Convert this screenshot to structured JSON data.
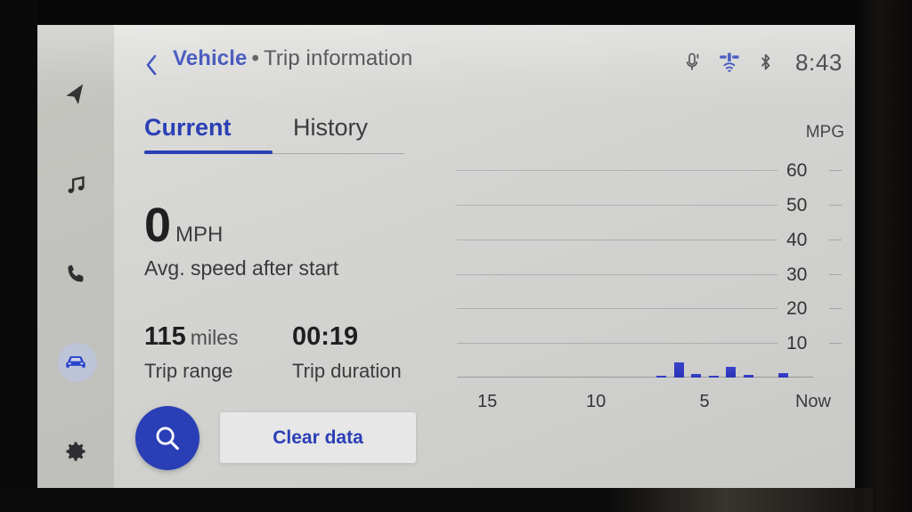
{
  "header": {
    "back_icon": "chevron-left-icon",
    "breadcrumb_parent": "Vehicle",
    "breadcrumb_separator": "•",
    "breadcrumb_current": "Trip information",
    "status_icons": [
      "mic-muted-icon",
      "gps-satellite-icon",
      "bluetooth-icon"
    ],
    "clock": "8:43"
  },
  "sidebar": {
    "items": [
      {
        "icon": "navigation-arrow-icon",
        "active": false
      },
      {
        "icon": "music-note-icon",
        "active": false
      },
      {
        "icon": "phone-icon",
        "active": false
      },
      {
        "icon": "car-icon",
        "active": true
      },
      {
        "icon": "gear-icon",
        "active": false
      }
    ]
  },
  "tabs": [
    {
      "label": "Current",
      "active": true
    },
    {
      "label": "History",
      "active": false
    }
  ],
  "stats": {
    "primary": {
      "value": "0",
      "unit": "MPH",
      "label": "Avg. speed after start"
    },
    "secondary": [
      {
        "value": "115",
        "unit": "miles",
        "label": "Trip range"
      },
      {
        "value": "00:19",
        "unit": "",
        "label": "Trip duration"
      }
    ]
  },
  "actions": {
    "search_icon": "search-icon",
    "clear_label": "Clear data"
  },
  "colors": {
    "accent_blue": "#2a3fb5",
    "bar_blue": "#2f37c4",
    "screen_bg": "#d6d7d4",
    "text_dark": "#333436"
  },
  "chart_data": {
    "type": "bar",
    "title": "",
    "xlabel": "",
    "ylabel": "MPG",
    "ylim": [
      0,
      65
    ],
    "yticks": [
      10,
      20,
      30,
      40,
      50,
      60
    ],
    "xticks": [
      {
        "label": "15",
        "pos": 15
      },
      {
        "label": "10",
        "pos": 10
      },
      {
        "label": "5",
        "pos": 5
      },
      {
        "label": "Now",
        "pos": 0
      }
    ],
    "xtick_note": "minutes ago",
    "grid": true,
    "legend": "none",
    "x": [
      15,
      14,
      13,
      12,
      11,
      10,
      9,
      8,
      7,
      6.2,
      5.4,
      4.6,
      3.8,
      3.0,
      2.2,
      1.4,
      0.6
    ],
    "values": [
      0,
      0,
      0,
      0,
      0,
      0,
      0,
      0,
      0.3,
      4.4,
      1.1,
      0.2,
      3.0,
      0.9,
      0,
      1.2,
      0
    ]
  }
}
